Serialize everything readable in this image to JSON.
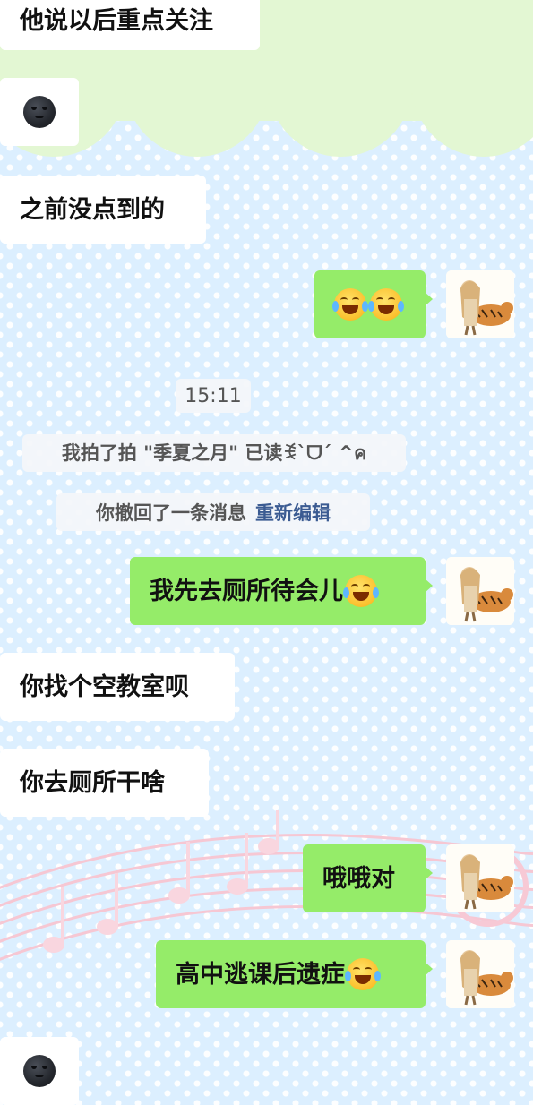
{
  "messages": [
    {
      "text": "他说以后重点关注"
    },
    {
      "text": "之前没点到的"
    },
    {
      "text": "我先去厕所待会儿"
    },
    {
      "text": "你找个空教室呗"
    },
    {
      "text": "你去厕所干啥"
    },
    {
      "text": "哦哦对"
    },
    {
      "text": "高中逃课后遗症"
    }
  ],
  "system": {
    "time": "15:11",
    "pat": "我拍了拍 \"季夏之月\" 已读ꉂ`ᗜ´ ^ค",
    "recall": "你撤回了一条消息",
    "reedit": "重新编辑"
  },
  "icons": {
    "moon": "new-moon-face-emoji",
    "laugh": "face-with-tears-of-joy-emoji",
    "cry": "loudly-crying-face-emoji",
    "avatar": "anime-girl-with-tiger-avatar"
  },
  "colors": {
    "outgoing_bubble": "#95ec69",
    "incoming_bubble": "#ffffff",
    "link": "#3b5b92"
  }
}
